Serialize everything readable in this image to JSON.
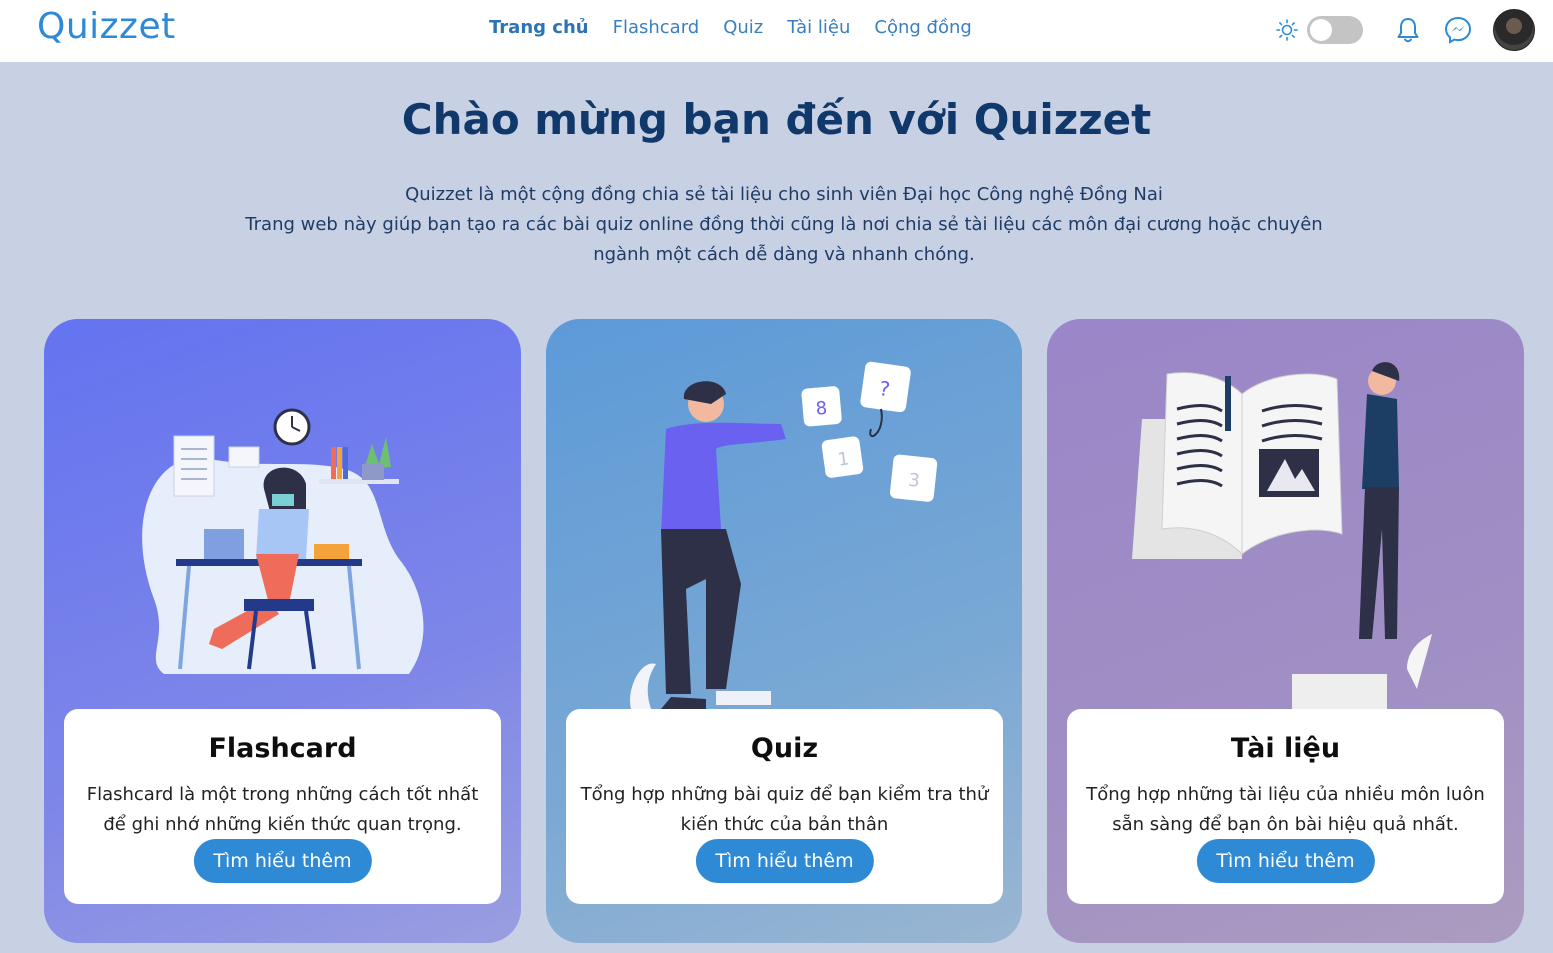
{
  "nav": {
    "logo": "Quizzet",
    "links": [
      "Trang chủ",
      "Flashcard",
      "Quiz",
      "Tài liệu",
      "Cộng đồng"
    ],
    "active_index": 0,
    "icons": [
      "sun-icon",
      "theme-toggle",
      "bell-icon",
      "messenger-icon",
      "avatar"
    ]
  },
  "hero": {
    "title": "Chào mừng bạn đến với Quizzet",
    "line1": "Quizzet là một cộng đồng chia sẻ tài liệu cho sinh viên Đại học Công nghệ Đồng Nai",
    "line2": "Trang web này giúp bạn tạo ra các bài quiz online đồng thời cũng là nơi chia sẻ tài liệu các môn đại cương hoặc chuyên ngành một cách dễ dàng và nhanh chóng."
  },
  "cards": [
    {
      "title": "Flashcard",
      "desc": "Flashcard là một trong những cách tốt nhất để ghi nhớ những kiến thức quan trọng.",
      "button": "Tìm hiểu thêm"
    },
    {
      "title": "Quiz",
      "desc": "Tổng hợp những bài quiz để bạn kiểm tra thử kiến thức của bản thân",
      "button": "Tìm hiểu thêm"
    },
    {
      "title": "Tài liệu",
      "desc": "Tổng hợp những tài liệu của nhiều môn luôn sẵn sàng để bạn ôn bài hiệu quả nhất.",
      "button": "Tìm hiểu thêm"
    }
  ],
  "colors": {
    "accent": "#2f8ad6",
    "title": "#11386a",
    "background": "#c8d0e4",
    "card_flashcard": "#6b77ea",
    "card_quiz": "#6ea1d6",
    "card_tailieu": "#9f8cc6"
  }
}
